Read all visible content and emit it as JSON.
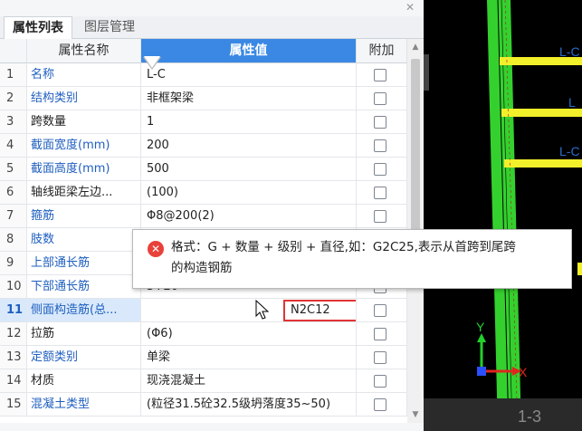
{
  "tabs": [
    "属性列表",
    "图层管理"
  ],
  "headers": {
    "num": "",
    "name": "属性名称",
    "value": "属性值",
    "add": "附加"
  },
  "rows": [
    {
      "num": "1",
      "name": "名称",
      "value": "L-C",
      "blue": true
    },
    {
      "num": "2",
      "name": "结构类别",
      "value": "非框架梁",
      "blue": true
    },
    {
      "num": "3",
      "name": "跨数量",
      "value": "1",
      "blue": false
    },
    {
      "num": "4",
      "name": "截面宽度(mm)",
      "value": "200",
      "blue": true
    },
    {
      "num": "5",
      "name": "截面高度(mm)",
      "value": "500",
      "blue": true
    },
    {
      "num": "6",
      "name": "轴线距梁左边...",
      "value": "(100)",
      "blue": false
    },
    {
      "num": "7",
      "name": "箍筋",
      "value": "Φ8@200(2)",
      "blue": true
    },
    {
      "num": "8",
      "name": "肢数",
      "value": "",
      "blue": true
    },
    {
      "num": "9",
      "name": "上部通长筋",
      "value": "",
      "blue": true
    },
    {
      "num": "10",
      "name": "下部通长筋",
      "value": "3Φ20",
      "blue": true
    },
    {
      "num": "11",
      "name": "侧面构造筋(总...",
      "value": "N2C12",
      "blue": true,
      "selected": true
    },
    {
      "num": "12",
      "name": "拉筋",
      "value": "(Φ6)",
      "blue": false
    },
    {
      "num": "13",
      "name": "定额类别",
      "value": "单梁",
      "blue": true
    },
    {
      "num": "14",
      "name": "材质",
      "value": "现浇混凝土",
      "blue": false
    },
    {
      "num": "15",
      "name": "混凝土类型",
      "value": "(粒径31.5砼32.5级坍落度35~50)",
      "blue": true
    }
  ],
  "tooltip": {
    "line1": "格式：G + 数量 + 级别 + 直径,如：G2C25,表示从首跨到尾跨",
    "line2": "的构造钢筋"
  },
  "canvas": {
    "labels": [
      "L-C",
      "L",
      "L-C"
    ],
    "axis_x": "X",
    "axis_y": "Y",
    "layer_label": "1-3"
  },
  "colors": {
    "accent": "#3a88e4",
    "link": "#1f5fbf",
    "error": "#e8413a",
    "beam_green": "#34d12e",
    "beam_yellow": "#f2ef2b"
  }
}
